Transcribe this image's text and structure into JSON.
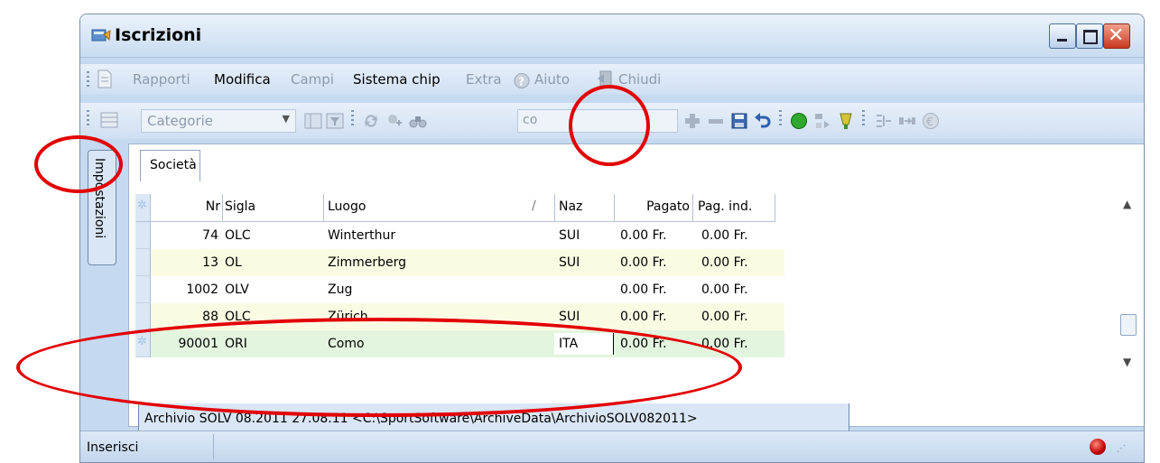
{
  "window": {
    "title": "Iscrizioni"
  },
  "menubar": {
    "items": [
      {
        "label": "Rapporti",
        "enabled": false
      },
      {
        "label": "Modifica",
        "enabled": true
      },
      {
        "label": "Campi",
        "enabled": false
      },
      {
        "label": "Sistema chip",
        "enabled": true
      },
      {
        "label": "Extra",
        "enabled": false
      },
      {
        "label": "Aiuto",
        "enabled": false
      },
      {
        "label": "Chiudi",
        "enabled": false
      }
    ]
  },
  "toolbar": {
    "category_combo": "Categorie",
    "search_value": "co"
  },
  "side_tab": {
    "label": "Impostazioni"
  },
  "tabs": [
    {
      "label": "Società"
    }
  ],
  "grid": {
    "columns": [
      "Nr",
      "Sigla",
      "Luogo",
      "Naz",
      "Pagato",
      "Pag. ind."
    ],
    "rows": [
      {
        "nr": "74",
        "sigla": "OLC",
        "luogo": "Winterthur",
        "naz": "SUI",
        "pagato": "0.00 Fr.",
        "pag_ind": "0.00 Fr."
      },
      {
        "nr": "13",
        "sigla": "OL",
        "luogo": "Zimmerberg",
        "naz": "SUI",
        "pagato": "0.00 Fr.",
        "pag_ind": "0.00 Fr."
      },
      {
        "nr": "1002",
        "sigla": "OLV",
        "luogo": "Zug",
        "naz": "",
        "pagato": "0.00 Fr.",
        "pag_ind": "0.00 Fr."
      },
      {
        "nr": "88",
        "sigla": "OLC",
        "luogo": "Zürich",
        "naz": "SUI",
        "pagato": "0.00 Fr.",
        "pag_ind": "0.00 Fr."
      },
      {
        "nr": "90001",
        "sigla": "ORI",
        "luogo": "Como",
        "naz": "ITA",
        "pagato": "0.00 Fr.",
        "pag_ind": "0.00 Fr."
      }
    ]
  },
  "archive_tab": {
    "label": "Archivio SOLV 08.2011  27.08.11  <C:\\SportSoftware\\ArchiveData\\ArchivioSOLV082011>"
  },
  "status": {
    "text": "Inserisci"
  }
}
